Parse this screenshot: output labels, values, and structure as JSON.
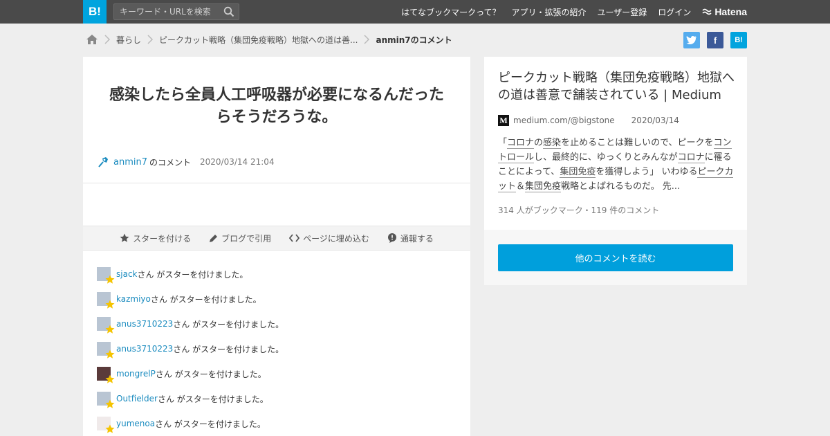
{
  "topbar": {
    "logo": "B!",
    "search_placeholder": "キーワード・URLを検索",
    "nav": [
      "はてなブックマークって？",
      "アプリ・拡張の紹介",
      "ユーザー登録",
      "ログイン"
    ],
    "brand": "Hatena"
  },
  "breadcrumb": {
    "items": [
      "暮らし",
      "ピークカット戦略（集団免疫戦略）地獄への道は善...",
      "anmin7のコメント"
    ]
  },
  "share": {
    "twitter": "t",
    "facebook": "f",
    "hatena": "B!"
  },
  "comment": {
    "text": "感染したら全員人工呼吸器が必要になるんだったらそうだろうな。",
    "user": "anmin7",
    "user_suffix": "のコメント",
    "datetime": "2020/03/14 21:04"
  },
  "actions": {
    "star": "スターを付ける",
    "blog": "ブログで引用",
    "embed": "ページに埋め込む",
    "report": "通報する"
  },
  "stars": {
    "suffix": "さん がスターを付けました。",
    "users": [
      "sjack",
      "kazmiyo",
      "anus3710223",
      "anus3710223",
      "mongrelP",
      "Outfielder",
      "yumenoa"
    ]
  },
  "entry": {
    "title": "ピークカット戦略（集団免疫戦略）地獄への道は善意で舗装されている | Medium",
    "domain": "medium.com/@bigstone",
    "date": "2020/03/14",
    "excerpt_parts": [
      "「",
      "コロナ",
      "の",
      "感染",
      "を止めることは難しいので、ピークを",
      "コントロール",
      "し、最終的に、ゆっくりとみんなが",
      "コロナ",
      "に罹ることによって、",
      "集団免疫",
      "を獲得しよう」 いわゆる",
      "ピークカット",
      "＆",
      "集団免疫",
      "戦略とよばれるものだ。 先..."
    ],
    "count": "314 人がブックマーク・119 件のコメント",
    "more_button": "他のコメントを読む"
  },
  "colors": {
    "accent": "#00a4de",
    "link": "#1a8bbf",
    "topbar": "#4a4a4a",
    "star": "#f5c400"
  }
}
